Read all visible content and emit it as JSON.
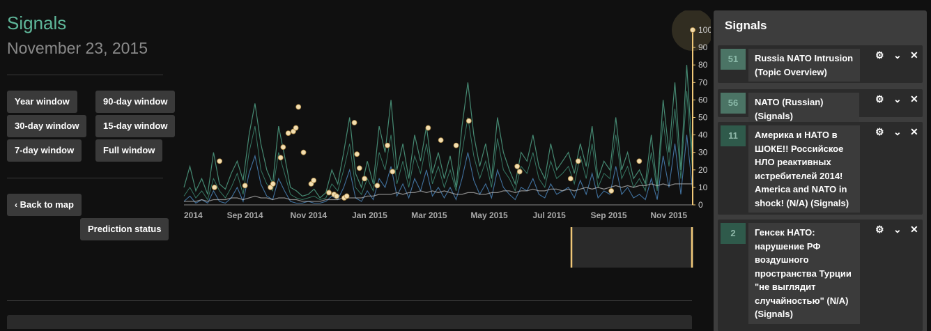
{
  "header": {
    "title": "Signals",
    "date": "November 23, 2015"
  },
  "buttons": {
    "year": "Year window",
    "d90": "90-day window",
    "d30": "30-day window",
    "d15": "15-day window",
    "d7": "7-day window",
    "full": "Full window",
    "back": "Back to map",
    "prediction": "Prediction status"
  },
  "icons": {
    "back": "chevron-left-icon",
    "settings": "gear-icon",
    "collapse": "chevron-down-icon",
    "close": "close-icon"
  },
  "colors": {
    "accent": "#5fb79a",
    "highlight": "#f0c878",
    "series_green": "#4f9f84",
    "series_blue": "#4a84b8",
    "series_white": "#bbbbbb"
  },
  "chart_data": {
    "type": "line",
    "x_ticks": [
      "2014",
      "Sep 2014",
      "Nov 2014",
      "Jan 2015",
      "Mar 2015",
      "May 2015",
      "Jul 2015",
      "Sep 2015",
      "Nov 2015"
    ],
    "y_ticks": [
      "0",
      "10",
      "20",
      "30",
      "40",
      "50",
      "60",
      "70",
      "80",
      "90",
      "100"
    ],
    "ylim": [
      0,
      100
    ],
    "series": [
      {
        "values": [
          10,
          22,
          8,
          15,
          6,
          30,
          12,
          9,
          18,
          25,
          14,
          40,
          58,
          35,
          20,
          12,
          45,
          28,
          10,
          8,
          5,
          6,
          9,
          4,
          7,
          20,
          12,
          30,
          50,
          18,
          10,
          25,
          12,
          45,
          30,
          60,
          20,
          35,
          15,
          40,
          25,
          45,
          18,
          30,
          15,
          28,
          10,
          45,
          70,
          40,
          22,
          35,
          15,
          50,
          30,
          20,
          12,
          30,
          25,
          40,
          22,
          15,
          35,
          20,
          25,
          30,
          18,
          35,
          22,
          45,
          15,
          25,
          20,
          50,
          20,
          30,
          15,
          20,
          12,
          40,
          10,
          60,
          30,
          70,
          20,
          80,
          25
        ]
      },
      {
        "values": [
          5,
          10,
          4,
          8,
          3,
          15,
          8,
          4,
          10,
          18,
          6,
          30,
          45,
          20,
          12,
          8,
          30,
          18,
          6,
          4,
          3,
          4,
          5,
          3,
          4,
          12,
          8,
          20,
          35,
          10,
          6,
          15,
          8,
          30,
          20,
          40,
          12,
          25,
          10,
          28,
          18,
          35,
          12,
          22,
          10,
          20,
          8,
          30,
          50,
          28,
          15,
          25,
          10,
          38,
          20,
          15,
          8,
          22,
          18,
          30,
          15,
          10,
          25,
          15,
          18,
          22,
          12,
          28,
          15,
          35,
          10,
          18,
          15,
          40,
          15,
          22,
          10,
          15,
          8,
          30,
          8,
          48,
          22,
          55,
          15,
          65,
          18
        ]
      },
      {
        "values": [
          2,
          5,
          1,
          3,
          1,
          8,
          2,
          1,
          4,
          10,
          2,
          18,
          28,
          12,
          5,
          3,
          15,
          8,
          2,
          1,
          1,
          2,
          1,
          1,
          2,
          5,
          3,
          10,
          20,
          4,
          2,
          8,
          3,
          15,
          10,
          22,
          5,
          12,
          4,
          15,
          8,
          20,
          5,
          10,
          4,
          10,
          3,
          15,
          30,
          14,
          6,
          12,
          4,
          20,
          10,
          6,
          3,
          10,
          8,
          15,
          6,
          4,
          12,
          6,
          8,
          10,
          4,
          14,
          6,
          18,
          4,
          8,
          6,
          22,
          6,
          10,
          4,
          6,
          3,
          15,
          3,
          28,
          10,
          35,
          6,
          40,
          8
        ]
      },
      {
        "values": [
          2,
          2,
          2,
          3,
          2,
          3,
          3,
          3,
          4,
          4,
          3,
          4,
          5,
          4,
          4,
          3,
          4,
          4,
          3,
          3,
          2,
          2,
          2,
          2,
          3,
          3,
          3,
          4,
          4,
          4,
          4,
          5,
          5,
          6,
          6,
          6,
          7,
          6,
          7,
          7,
          8,
          7,
          8,
          7,
          8,
          7,
          6,
          6,
          7,
          7,
          6,
          6,
          7,
          7,
          8,
          8,
          7,
          8,
          8,
          9,
          8,
          8,
          9,
          9,
          8,
          9,
          8,
          9,
          10,
          9,
          10,
          9,
          10,
          11,
          10,
          11,
          10,
          11,
          11,
          12,
          11,
          12,
          11,
          12,
          12,
          12,
          12
        ]
      }
    ],
    "annotation_points": [
      {
        "x": 0.06,
        "y": 10
      },
      {
        "x": 0.07,
        "y": 25
      },
      {
        "x": 0.12,
        "y": 11
      },
      {
        "x": 0.17,
        "y": 10
      },
      {
        "x": 0.175,
        "y": 12
      },
      {
        "x": 0.19,
        "y": 27
      },
      {
        "x": 0.195,
        "y": 33
      },
      {
        "x": 0.205,
        "y": 41
      },
      {
        "x": 0.215,
        "y": 42
      },
      {
        "x": 0.22,
        "y": 44
      },
      {
        "x": 0.225,
        "y": 56
      },
      {
        "x": 0.235,
        "y": 30
      },
      {
        "x": 0.25,
        "y": 12
      },
      {
        "x": 0.255,
        "y": 14
      },
      {
        "x": 0.285,
        "y": 7
      },
      {
        "x": 0.295,
        "y": 6
      },
      {
        "x": 0.3,
        "y": 5
      },
      {
        "x": 0.315,
        "y": 4
      },
      {
        "x": 0.32,
        "y": 5
      },
      {
        "x": 0.335,
        "y": 47
      },
      {
        "x": 0.34,
        "y": 29
      },
      {
        "x": 0.345,
        "y": 21
      },
      {
        "x": 0.355,
        "y": 15
      },
      {
        "x": 0.38,
        "y": 11
      },
      {
        "x": 0.4,
        "y": 34
      },
      {
        "x": 0.41,
        "y": 19
      },
      {
        "x": 0.48,
        "y": 44
      },
      {
        "x": 0.505,
        "y": 37
      },
      {
        "x": 0.535,
        "y": 34
      },
      {
        "x": 0.56,
        "y": 48
      },
      {
        "x": 0.655,
        "y": 22
      },
      {
        "x": 0.66,
        "y": 19
      },
      {
        "x": 0.76,
        "y": 15
      },
      {
        "x": 0.775,
        "y": 25
      },
      {
        "x": 0.84,
        "y": 8
      },
      {
        "x": 0.895,
        "y": 25
      },
      {
        "x": 1.0,
        "y": 100
      }
    ]
  },
  "signals_panel": {
    "title": "Signals",
    "cards": [
      {
        "count": "51",
        "lines": [
          "Russia NATO Intrusion",
          "(Topic Overview)"
        ]
      },
      {
        "count": "56",
        "lines": [
          "NATO (Russian) (Signals)"
        ]
      },
      {
        "count": "11",
        "lines": [
          "Америка и НАТО в",
          "ШОКЕ!! Российское",
          "НЛО реактивных",
          "истребителей 2014!",
          "America and NATO in",
          "shock! (N/A) (Signals)"
        ]
      },
      {
        "count": "2",
        "lines": [
          "Генсек НАТО:",
          "нарушение РФ",
          "воздушного",
          "пространства Турции",
          "\"не выглядит",
          "случайностью\" (N/A)",
          "(Signals)"
        ]
      }
    ]
  }
}
